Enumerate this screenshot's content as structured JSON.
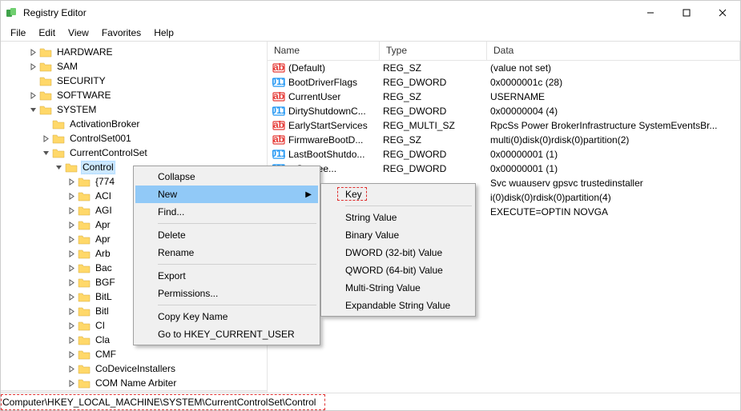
{
  "window": {
    "title": "Registry Editor"
  },
  "menubar": [
    "File",
    "Edit",
    "View",
    "Favorites",
    "Help"
  ],
  "tree": {
    "top": [
      {
        "label": "HARDWARE",
        "expander": ">",
        "indent": 2
      },
      {
        "label": "SAM",
        "expander": ">",
        "indent": 2
      },
      {
        "label": "SECURITY",
        "expander": "",
        "indent": 2
      },
      {
        "label": "SOFTWARE",
        "expander": ">",
        "indent": 2
      },
      {
        "label": "SYSTEM",
        "expander": "v",
        "indent": 2
      },
      {
        "label": "ActivationBroker",
        "expander": "",
        "indent": 3
      },
      {
        "label": "ControlSet001",
        "expander": ">",
        "indent": 3
      },
      {
        "label": "CurrentControlSet",
        "expander": "v",
        "indent": 3
      },
      {
        "label": "Control",
        "expander": "v",
        "indent": 4,
        "selected": true
      }
    ],
    "cut": [
      {
        "label": "{774",
        "indent": 5
      },
      {
        "label": "ACI",
        "indent": 5
      },
      {
        "label": "AGI",
        "indent": 5
      },
      {
        "label": "Apr",
        "indent": 5
      },
      {
        "label": "Apr",
        "indent": 5
      },
      {
        "label": "Arb",
        "indent": 5
      },
      {
        "label": "Bac",
        "indent": 5
      },
      {
        "label": "BGF",
        "indent": 5
      },
      {
        "label": "BitL",
        "indent": 5
      },
      {
        "label": "Bitl",
        "indent": 5
      },
      {
        "label": "CI",
        "indent": 5
      },
      {
        "label": "Cla",
        "indent": 5
      },
      {
        "label": "CMF",
        "indent": 5
      },
      {
        "label": "CoDeviceInstallers",
        "indent": 5
      },
      {
        "label": "COM Name Arbiter",
        "indent": 5
      }
    ]
  },
  "list": {
    "columns": {
      "name": "Name",
      "type": "Type",
      "data": "Data"
    },
    "rows": [
      {
        "icon": "ab",
        "name": "(Default)",
        "type": "REG_SZ",
        "data": "(value not set)"
      },
      {
        "icon": "bin",
        "name": "BootDriverFlags",
        "type": "REG_DWORD",
        "data": "0x0000001c (28)"
      },
      {
        "icon": "ab",
        "name": "CurrentUser",
        "type": "REG_SZ",
        "data": "USERNAME"
      },
      {
        "icon": "bin",
        "name": "DirtyShutdownC...",
        "type": "REG_DWORD",
        "data": "0x00000004 (4)"
      },
      {
        "icon": "ab",
        "name": "EarlyStartServices",
        "type": "REG_MULTI_SZ",
        "data": "RpcSs Power BrokerInfrastructure SystemEventsBr..."
      },
      {
        "icon": "ab",
        "name": "FirmwareBootD...",
        "type": "REG_SZ",
        "data": "multi(0)disk(0)rdisk(0)partition(2)"
      },
      {
        "icon": "bin",
        "name": "LastBootShutdo...",
        "type": "REG_DWORD",
        "data": "0x00000001 (1)"
      },
      {
        "icon": "bin",
        "name": "otSuccee...",
        "type": "REG_DWORD",
        "data": "0x00000001 (1)"
      },
      {
        "icon": "",
        "name": "",
        "type": "",
        "data": "Svc wuauserv gpsvc trustedinstaller"
      },
      {
        "icon": "",
        "name": "",
        "type": "",
        "data": "i(0)disk(0)rdisk(0)partition(4)"
      },
      {
        "icon": "",
        "name": "",
        "type": "",
        "data": "EXECUTE=OPTIN  NOVGA"
      }
    ]
  },
  "ctx": {
    "main": {
      "collapse": "Collapse",
      "new": "New",
      "find": "Find...",
      "delete": "Delete",
      "rename": "Rename",
      "export": "Export",
      "permissions": "Permissions...",
      "copykey": "Copy Key Name",
      "goto": "Go to HKEY_CURRENT_USER"
    },
    "sub": {
      "key": "Key",
      "string": "String Value",
      "binary": "Binary Value",
      "dword": "DWORD (32-bit) Value",
      "qword": "QWORD (64-bit) Value",
      "multi": "Multi-String Value",
      "expand": "Expandable String Value"
    }
  },
  "status": {
    "path": "Computer\\HKEY_LOCAL_MACHINE\\SYSTEM\\CurrentControlSet\\Control"
  }
}
